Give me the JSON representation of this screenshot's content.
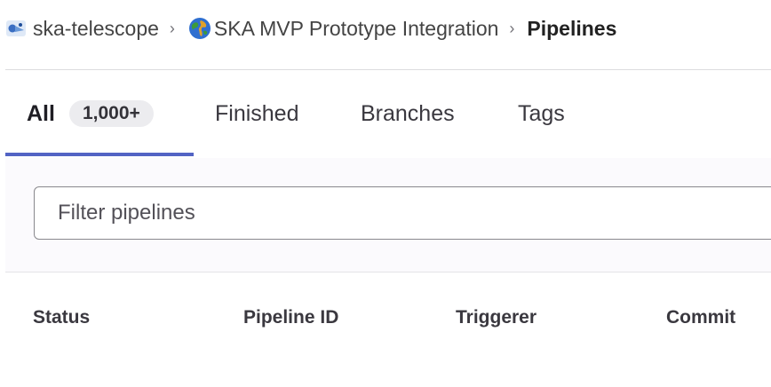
{
  "breadcrumb": {
    "group": "ska-telescope",
    "project": "SKA MVP Prototype Integration",
    "current": "Pipelines",
    "separator": "›"
  },
  "tabs": [
    {
      "label": "All",
      "badge": "1,000+",
      "active": true
    },
    {
      "label": "Finished"
    },
    {
      "label": "Branches"
    },
    {
      "label": "Tags"
    }
  ],
  "filter": {
    "placeholder": "Filter pipelines",
    "value": ""
  },
  "table": {
    "columns": [
      "Status",
      "Pipeline ID",
      "Triggerer",
      "Commit"
    ]
  },
  "colors": {
    "active_tab_underline": "#5263c4",
    "badge_bg": "#ececef"
  },
  "icons": {
    "group_avatar": "ska-group-avatar-icon",
    "project_avatar": "globe-icon"
  }
}
